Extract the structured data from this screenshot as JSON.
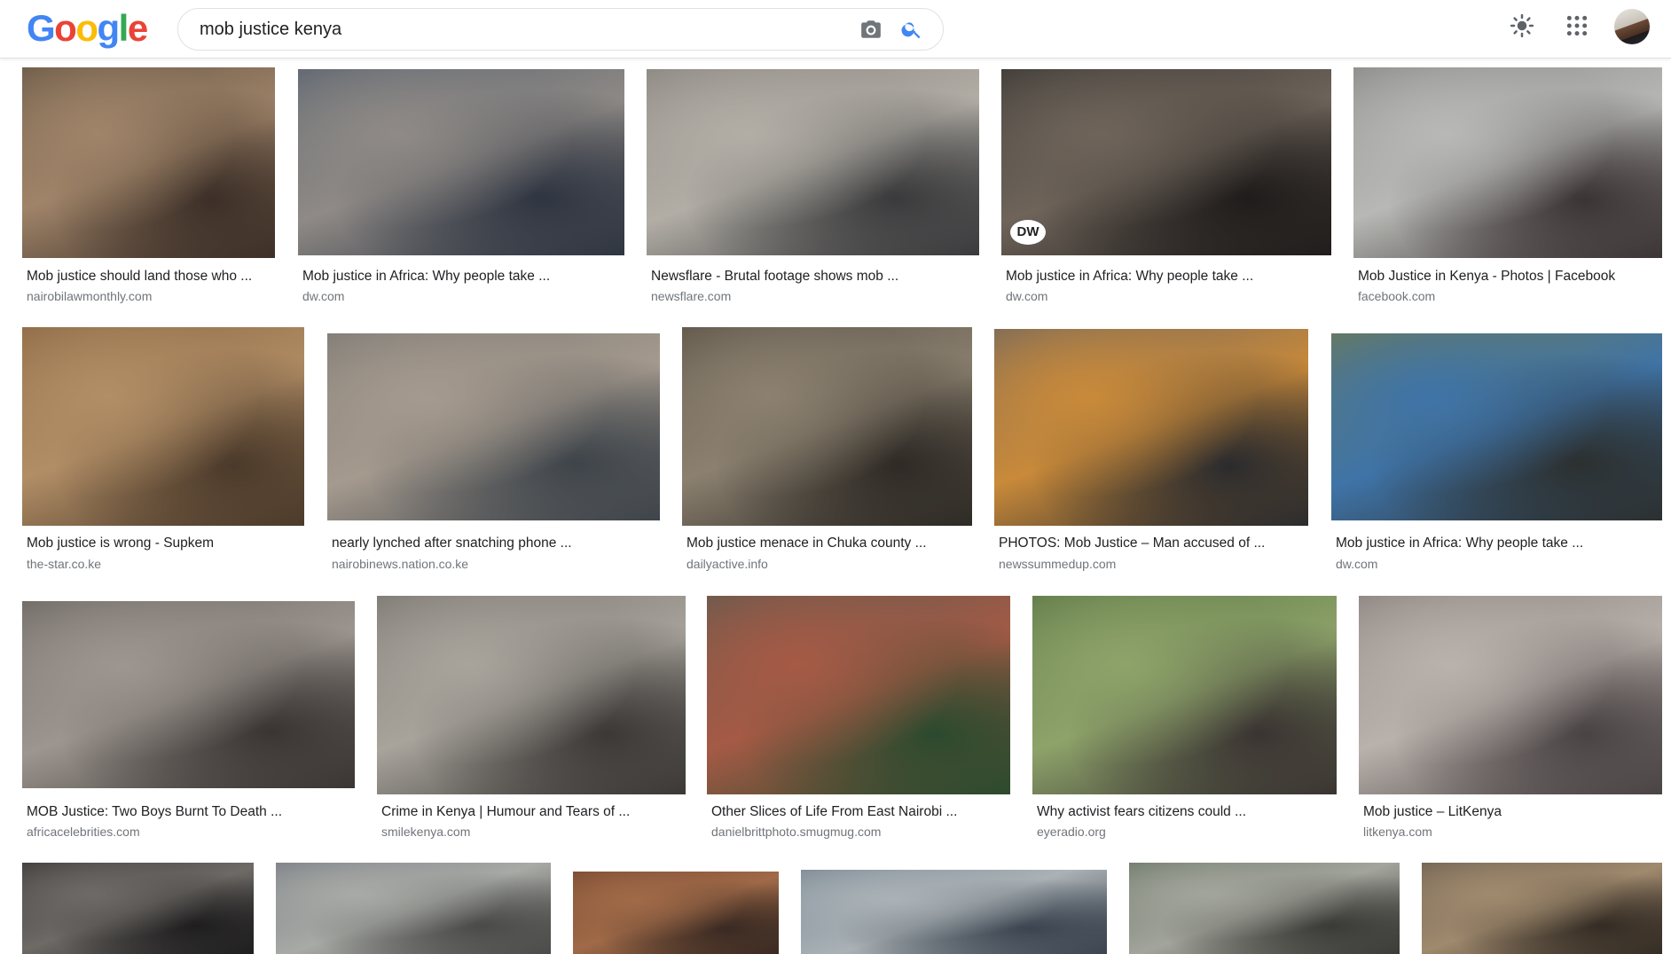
{
  "logo": {
    "letters": [
      "G",
      "o",
      "o",
      "g",
      "l",
      "e"
    ],
    "colors": [
      "#4285F4",
      "#EA4335",
      "#FBBC05",
      "#4285F4",
      "#34A853",
      "#EA4335"
    ]
  },
  "search": {
    "query": "mob justice kenya"
  },
  "icons": {
    "camera": "camera-icon",
    "search": "search-icon",
    "brightness": "brightness-icon",
    "apps": "apps-grid-icon",
    "avatar": "account-avatar"
  },
  "colors": {
    "search_blue": "#4285F4",
    "caption_source": "#70757a"
  },
  "results": [
    {
      "title": "Mob justice should land those who ...",
      "source": "nairobilawmonthly.com",
      "colors": [
        "#6b5a48",
        "#a08469",
        "#3c2f27"
      ]
    },
    {
      "title": "Mob justice in Africa: Why people take ...",
      "source": "dw.com",
      "colors": [
        "#5d6570",
        "#8f8a86",
        "#2f3541"
      ]
    },
    {
      "title": "Newsflare - Brutal footage shows mob ...",
      "source": "newsflare.com",
      "colors": [
        "#8a8680",
        "#b2aea6",
        "#3a3a3c"
      ]
    },
    {
      "title": "Mob justice in Africa: Why people take ...",
      "source": "dw.com",
      "colors": [
        "#3e3a36",
        "#6e645a",
        "#1f1c1b"
      ],
      "watermark": "DW"
    },
    {
      "title": "Mob Justice in Kenya - Photos | Facebook",
      "source": "facebook.com",
      "colors": [
        "#8a8b88",
        "#b8b9b6",
        "#3b3434"
      ]
    },
    {
      "title": "Mob justice is wrong - Supkem",
      "source": "the-star.co.ke",
      "colors": [
        "#8d6a46",
        "#b28e66",
        "#4b3a2a"
      ]
    },
    {
      "title": "nearly lynched after snatching phone ...",
      "source": "nairobinews.nation.co.ke",
      "colors": [
        "#7f7b76",
        "#a59a8e",
        "#3e444a"
      ]
    },
    {
      "title": "Mob justice menace in Chuka county ...",
      "source": "dailyactive.info",
      "colors": [
        "#5e5549",
        "#8c8170",
        "#2e2a25"
      ]
    },
    {
      "title": "PHOTOS: Mob Justice – Man accused of ...",
      "source": "newssummedup.com",
      "colors": [
        "#7a6a5a",
        "#c98a3a",
        "#2b2b2d"
      ]
    },
    {
      "title": "Mob justice in Africa: Why people take ...",
      "source": "dw.com",
      "colors": [
        "#6b7a5a",
        "#3f74a8",
        "#2c3030"
      ]
    },
    {
      "title": "MOB Justice: Two Boys Burnt To Death ...",
      "source": "africacelebrities.com",
      "colors": [
        "#6e6863",
        "#9d9690",
        "#3a3533"
      ]
    },
    {
      "title": "Crime in Kenya | Humour and Tears of ...",
      "source": "smilekenya.com",
      "colors": [
        "#7c7872",
        "#a8a49c",
        "#3b3836"
      ]
    },
    {
      "title": "Other Slices of Life From East Nairobi ...",
      "source": "danielbrittphoto.smugmug.com",
      "colors": [
        "#6a5a4e",
        "#a55a45",
        "#2c4a2e"
      ]
    },
    {
      "title": "Why activist fears citizens could ...",
      "source": "eyeradio.org",
      "colors": [
        "#5f7a48",
        "#8ea36a",
        "#3a3432"
      ]
    },
    {
      "title": "Mob justice – LitKenya",
      "source": "litkenya.com",
      "colors": [
        "#8c8480",
        "#b9b2ac",
        "#4a4344"
      ]
    },
    {
      "colors": [
        "#3c3a3a",
        "#6e6a66",
        "#1f1e1f"
      ]
    },
    {
      "colors": [
        "#7a7f86",
        "#a8aaa6",
        "#4a4a48"
      ]
    },
    {
      "colors": [
        "#7a4a32",
        "#a06a48",
        "#3a2a22"
      ]
    },
    {
      "colors": [
        "#7d8a96",
        "#aab2b6",
        "#3c4450"
      ]
    },
    {
      "colors": [
        "#6e7a6a",
        "#a3a59c",
        "#3a3a36"
      ]
    },
    {
      "colors": [
        "#6f6152",
        "#a08a6e",
        "#342c24"
      ]
    }
  ]
}
